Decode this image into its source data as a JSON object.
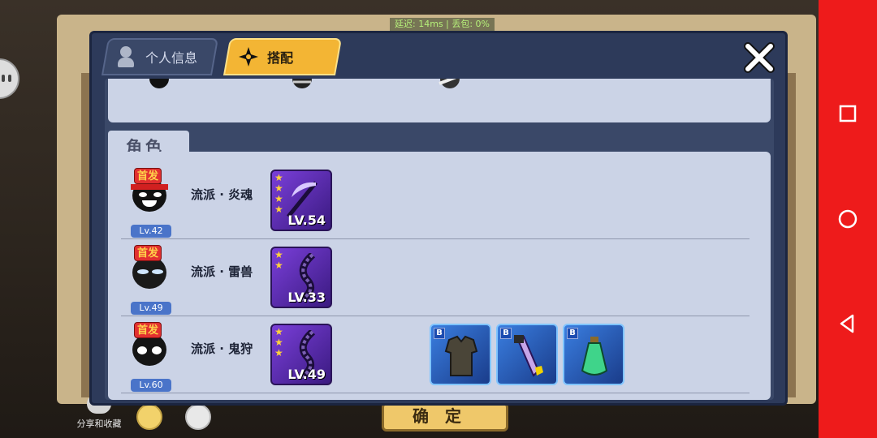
{
  "status_bar": {
    "network": "延迟: 14ms  |  丢包: 0%"
  },
  "tabs": [
    {
      "label": "个人信息",
      "active": false,
      "icon": "person-icon"
    },
    {
      "label": "搭配",
      "active": true,
      "icon": "shuriken-icon"
    }
  ],
  "close_icon": "close-icon",
  "section": {
    "title": "角色"
  },
  "roles": [
    {
      "badge": "首发",
      "level": "Lv.42",
      "school": "流派 · 炎魂",
      "weapon_level": "LV.54",
      "weapon_stars": 4,
      "items": []
    },
    {
      "badge": "首发",
      "level": "Lv.49",
      "school": "流派 · 雷兽",
      "weapon_level": "LV.33",
      "weapon_stars": 2,
      "items": []
    },
    {
      "badge": "首发",
      "level": "Lv.60",
      "school": "流派 · 鬼狩",
      "weapon_level": "LV.49",
      "weapon_stars": 3,
      "items": [
        {
          "grade": "B",
          "type": "armor-icon"
        },
        {
          "grade": "B",
          "type": "blade-icon"
        },
        {
          "grade": "B",
          "type": "potion-icon"
        }
      ]
    }
  ],
  "bottom": {
    "share_label": "分享和收藏",
    "confirm_label": "确定"
  },
  "colors": {
    "active_tab": "#f3b534",
    "panel": "#2d3a5a",
    "navbar": "#ee1b1b"
  }
}
